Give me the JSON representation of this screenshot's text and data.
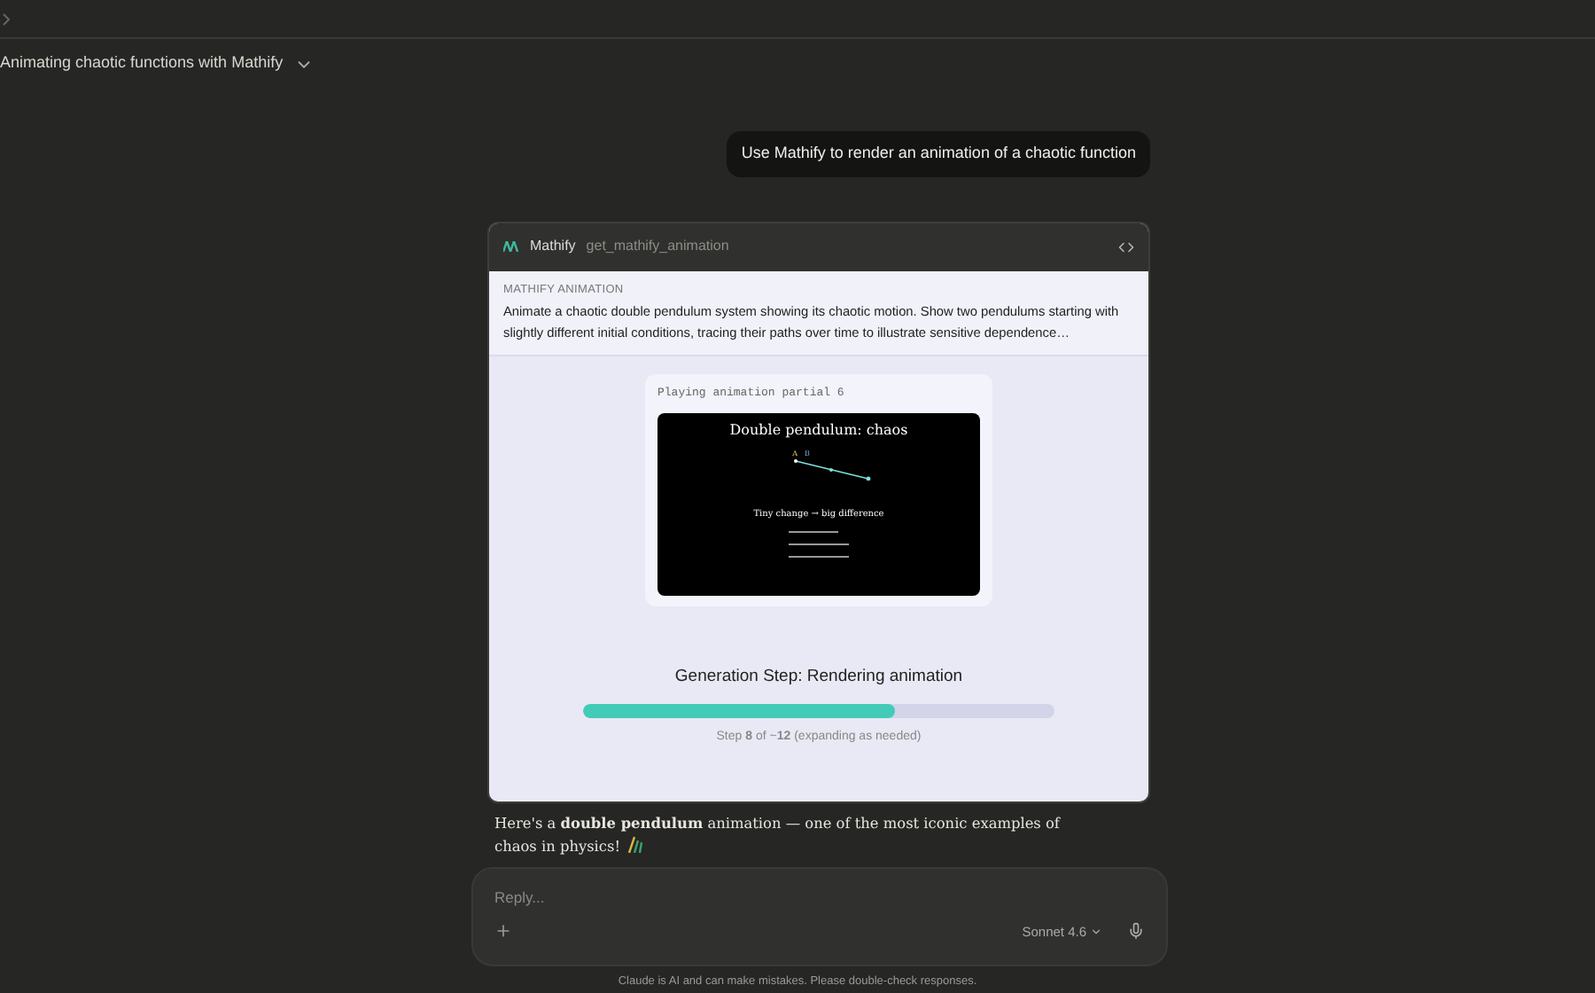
{
  "conversation": {
    "title": "Animating chaotic functions with Mathify"
  },
  "user_message": "Use Mathify to render an animation of a chaotic function",
  "tool_call": {
    "app": "Mathify",
    "function": "get_mathify_animation",
    "section_label": "MATHIFY ANIMATION",
    "prompt": "Animate a chaotic double pendulum system showing its chaotic motion. Show two pendulums starting with slightly different initial conditions, tracing their paths over time to illustrate sensitive dependence…",
    "status": "Playing animation partial 6",
    "frame": {
      "title": "Double pendulum: chaos",
      "labels": [
        "A",
        "B"
      ],
      "caption": "Tiny change → big difference"
    },
    "step_title": "Generation Step: Rendering animation",
    "progress": {
      "level": 0.66,
      "text": "Step **8** of ~**12** (expanding as needed)"
    }
  },
  "assistant_message": "Here's a **double pendulum** animation — one of the most iconic examples of chaos in physics!",
  "composer": {
    "placeholder": "Reply...",
    "model": "Sonnet 4.6"
  },
  "disclaimer": "Claude is AI and can make mistakes. Please double-check responses."
}
